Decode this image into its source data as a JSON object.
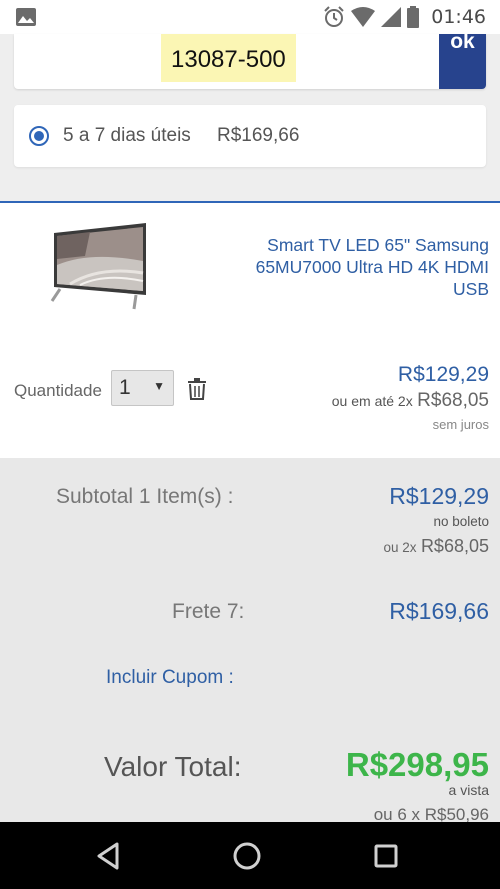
{
  "status_bar": {
    "time": "01:46",
    "icons": [
      "image-icon",
      "alarm-icon",
      "wifi-icon",
      "signal-icon",
      "battery-icon"
    ]
  },
  "cep": {
    "value": "13087-500",
    "ok_label": "ok"
  },
  "shipping_option": {
    "label": "5 a 7 dias úteis",
    "price": "R$169,66"
  },
  "product": {
    "name": "Smart TV LED 65\" Samsung 65MU7000 Ultra HD 4K HDMI USB",
    "quantity_label": "Quantidade",
    "quantity_value": "1",
    "price": "R$129,29",
    "installment_prefix": "ou em até 2x",
    "installment_value": "R$68,05",
    "no_interest": "sem juros"
  },
  "summary": {
    "subtotal_label": "Subtotal 1 Item(s) :",
    "subtotal_price": "R$129,29",
    "boleto_label": "no boleto",
    "subtotal_installment_prefix": "ou 2x",
    "subtotal_installment_value": "R$68,05",
    "shipping_label": "Frete 7:",
    "shipping_price": "R$169,66",
    "coupon_label": "Incluir Cupom :",
    "total_label": "Valor Total:",
    "total_price": "R$298,95",
    "cash_label": "a vista",
    "total_installment": "ou 6 x R$50,96"
  },
  "colors": {
    "brand_blue": "#2f5fa4",
    "button_blue": "#27438d",
    "total_green": "#3db54a",
    "cep_highlight": "#fbf6b4"
  },
  "nav_bar": {
    "icons": [
      "back-icon",
      "home-icon",
      "recents-icon"
    ]
  }
}
